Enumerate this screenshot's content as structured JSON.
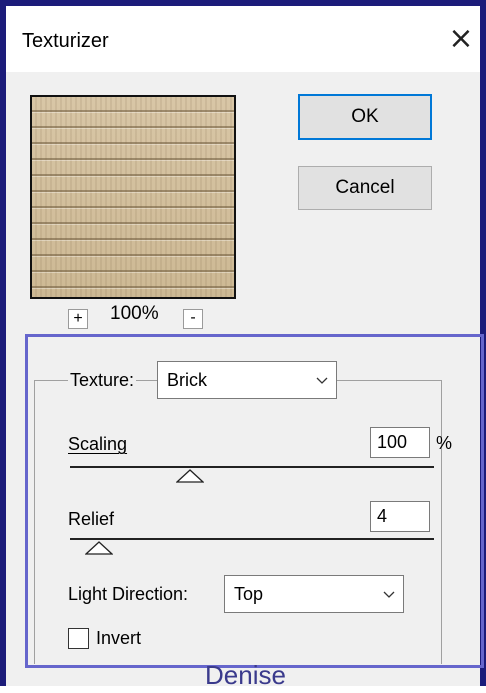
{
  "window": {
    "title": "Texturizer",
    "close_icon": "close-icon"
  },
  "preview": {
    "zoom_plus": "+",
    "zoom_level": "100%",
    "zoom_minus": "-"
  },
  "buttons": {
    "ok": "OK",
    "cancel": "Cancel"
  },
  "texture": {
    "label": "Texture:",
    "value": "Brick"
  },
  "scaling": {
    "label": "Scaling",
    "value": "100",
    "unit": "%",
    "slider_fraction": 0.33
  },
  "relief": {
    "label": "Relief",
    "value": "4",
    "slider_fraction": 0.08
  },
  "light_direction": {
    "label": "Light Direction:",
    "value": "Top"
  },
  "invert": {
    "label": "Invert",
    "checked": false
  },
  "watermark": "Denise",
  "colors": {
    "frame": "#1c1c7a",
    "highlight": "#6666cc",
    "accent": "#0078d7",
    "texture": "#d4c2a0"
  }
}
